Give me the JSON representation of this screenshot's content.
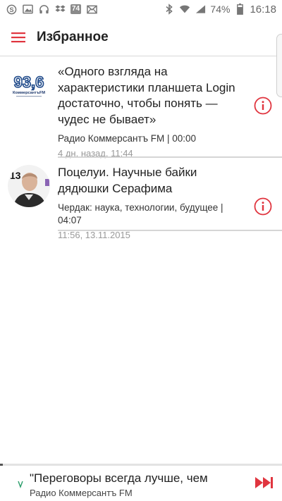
{
  "status_bar": {
    "left_icons": [
      "skype-icon",
      "picture-icon",
      "headphones-icon",
      "dropbox-icon"
    ],
    "badge": "74",
    "battery_percent": "74%",
    "time": "16:18"
  },
  "app_bar": {
    "title": "Избранное"
  },
  "items": [
    {
      "title": "«Одного взгляда на характеристики планшета Login достаточно, чтобы понять — чудес не бывает»",
      "station": "Радио Коммерсантъ FM | 00:00",
      "date": "4 дн. назад, 11:44",
      "logo_digits": "93,6",
      "logo_brand": "КоммерсантъFM"
    },
    {
      "title": "Поцелуи. Научные байки дядюшки Серафима",
      "station": "Чердак: наука, технологии, будущее | 04:07",
      "date": "11:56, 13.11.2015",
      "avatar_number": "13"
    }
  ],
  "player": {
    "title": "\"Переговоры всегда лучше, чем",
    "station": "Радио Коммерсантъ FM",
    "progress": 0.01
  },
  "colors": {
    "accent": "#e0353f",
    "divider": "#d5d5d5",
    "date_text": "#999999"
  }
}
